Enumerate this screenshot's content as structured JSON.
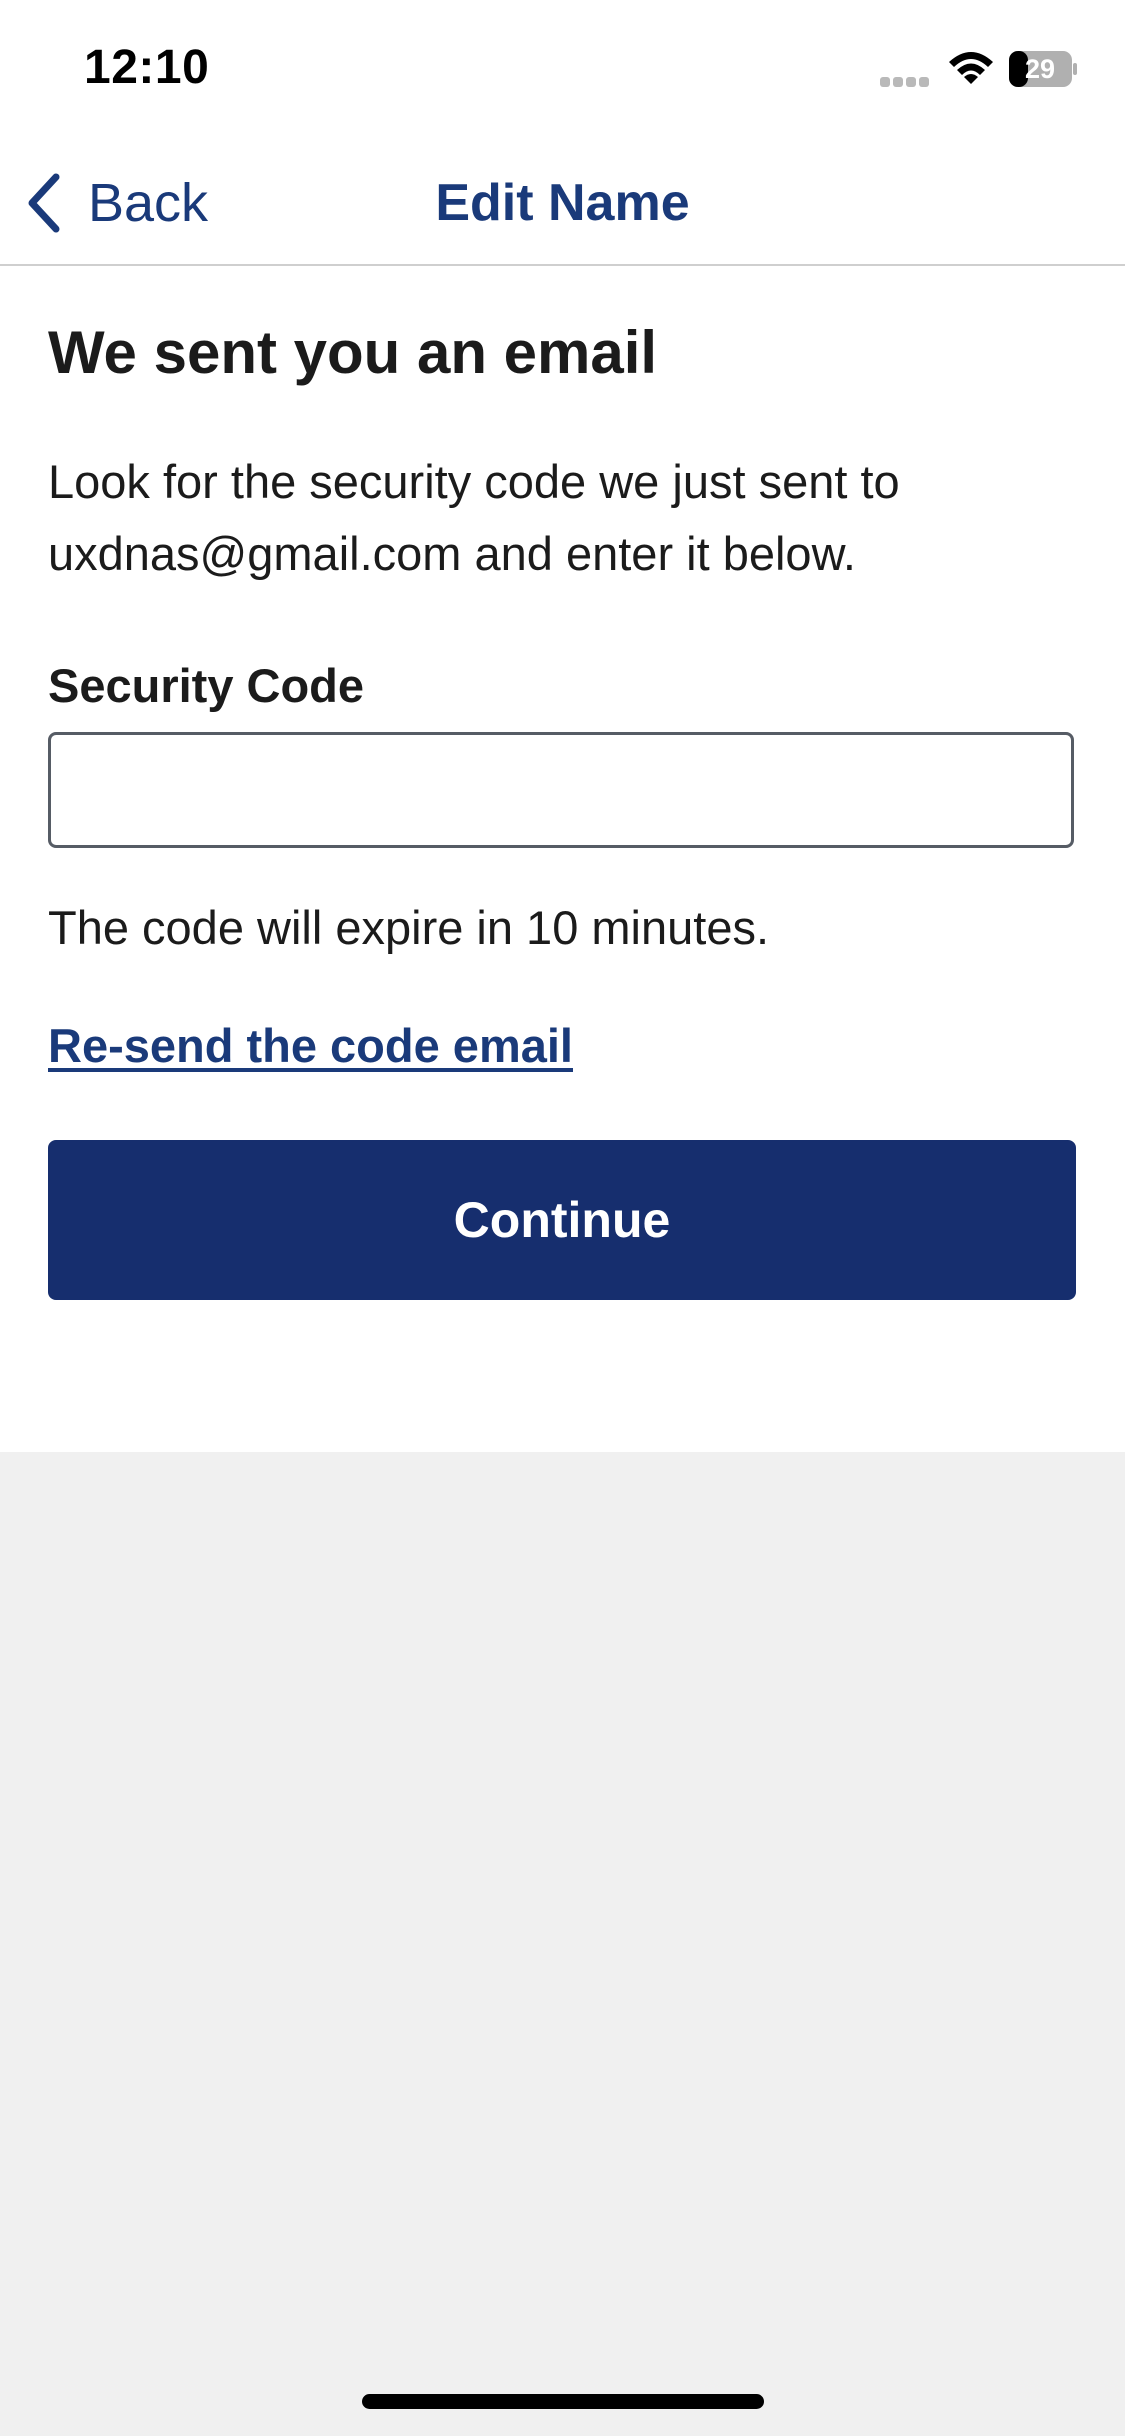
{
  "status_bar": {
    "time": "12:10",
    "battery_level": "29",
    "icons": [
      "signal-icon",
      "wifi-icon",
      "battery-icon"
    ]
  },
  "nav": {
    "back_label": "Back",
    "back_icon": "chevron-left-icon",
    "title": "Edit Name"
  },
  "main": {
    "heading": "We sent you an email",
    "intro": "Look for the security code we just sent to uxdnas@gmail.com and enter it below.",
    "field_label": "Security Code",
    "field_value": "",
    "expire_note": "The code will expire in 10 minutes.",
    "resend_link": "Re-send the code email",
    "continue_label": "Continue"
  },
  "colors": {
    "primary": "#162e6e",
    "link": "#1a3a7a",
    "text": "#1b1b1b",
    "background": "#f0f0f0"
  }
}
